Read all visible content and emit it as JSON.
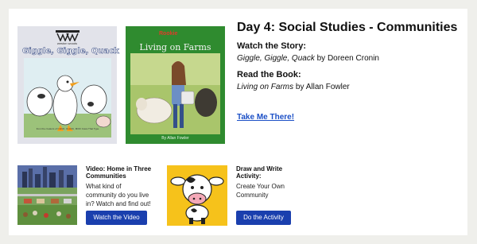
{
  "day_title": "Day 4: Social Studies - Communities",
  "story": {
    "heading": "Watch the Story:",
    "title": "Giggle, Giggle, Quack",
    "author": " by Doreen Cronin"
  },
  "book": {
    "heading": "Read the Book:",
    "title": "Living on Farms",
    "author": " by Allan Fowler"
  },
  "link_label": "Take Me There!",
  "cover1": {
    "brand": "weston woods",
    "title": "Giggle, Giggle, Quack",
    "blurb": "from the creators of CLICK, CLACK, MOO Cows That Type"
  },
  "cover2": {
    "badge": "Rookie",
    "title": "Living on Farms",
    "author": "By Allan Fowler"
  },
  "activities": [
    {
      "title_line1": "Video: Home in Three",
      "title_line2": "Communities",
      "desc_line1": "What kind of",
      "desc_line2": "community do you live",
      "desc_line3": "in? Watch and find out!",
      "button": "Watch the Video"
    },
    {
      "title_line1": "Draw and Write",
      "title_line2": "Activity:",
      "desc_line1": "Create Your Own",
      "desc_line2": "Community",
      "button": "Do the Activity"
    }
  ],
  "colors": {
    "background": "#efefeb",
    "button": "#1a3fae",
    "link": "#1b4fc6",
    "cow_thumb_bg": "#f6c21b"
  }
}
